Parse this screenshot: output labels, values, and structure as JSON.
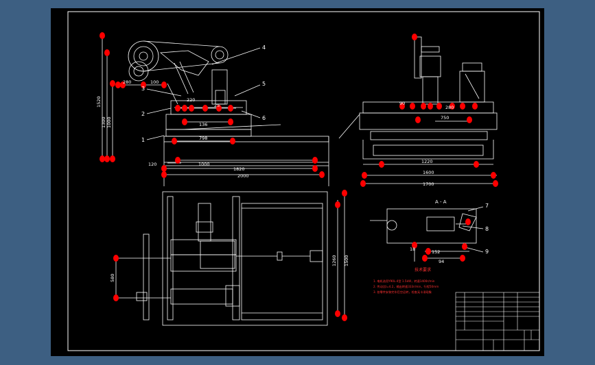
{
  "colors": {
    "background": "#3d5f82",
    "sheet": "#000000",
    "line": "#ffffff",
    "grip": "#ff0000",
    "note": "#ff3030"
  },
  "front_view": {
    "dims_vertical": [
      "1520",
      "1300",
      "1000"
    ],
    "dims_horizontal": [
      "798",
      "1000",
      "1820",
      "2000"
    ],
    "small_dims": [
      "280",
      "100",
      "220",
      "25",
      "136",
      "120"
    ],
    "leaders": [
      "4",
      "3",
      "5",
      "2",
      "6",
      "1"
    ]
  },
  "side_view": {
    "dims_horizontal": [
      "1220",
      "1600",
      "1700",
      "750",
      "280",
      "90"
    ]
  },
  "plan_view": {
    "dims_vertical": [
      "1260",
      "1500",
      "580"
    ]
  },
  "section_view": {
    "title": "A - A",
    "dims": [
      "152",
      "94",
      "18"
    ],
    "leaders": [
      "7",
      "8",
      "9"
    ]
  },
  "notes": {
    "title": "技术要求",
    "lines": [
      "1. 电机选用Y90L-4型 1.5kW，转速1400r/min",
      "2. 传动比I=4.2，输出转速333r/min，行程50mm",
      "3. 各零件安装完毕后空运转，检查无卡滞现象"
    ]
  }
}
